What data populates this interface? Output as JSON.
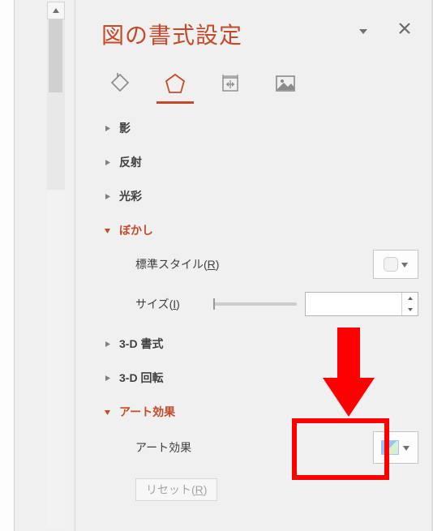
{
  "panel": {
    "title": "図の書式設定",
    "tabs": {
      "fill": "fill-line-tab",
      "effects": "effects-tab",
      "size": "size-properties-tab",
      "picture": "picture-tab"
    }
  },
  "sections": {
    "shadow": "影",
    "reflection": "反射",
    "glow": "光彩",
    "blur": "ぼかし",
    "format3d": "3-D 書式",
    "rotate3d": "3-D 回転",
    "artistic": "アート効果"
  },
  "blur": {
    "preset_label_prefix": "標準スタイル(",
    "preset_label_key": "R",
    "preset_label_suffix": ")",
    "size_label_prefix": "サイズ(",
    "size_label_key": "I",
    "size_label_suffix": ")",
    "size_value": ""
  },
  "artistic": {
    "label": "アート効果"
  },
  "reset": {
    "prefix": "リセット(",
    "key": "R",
    "suffix": ")"
  }
}
